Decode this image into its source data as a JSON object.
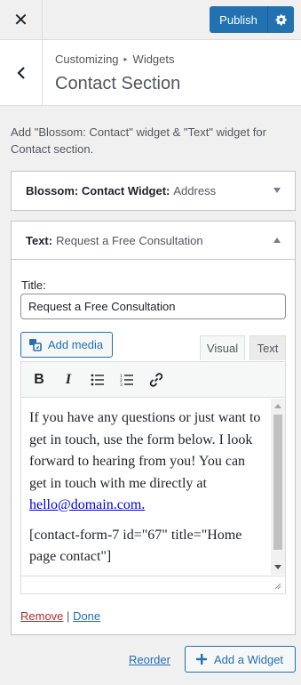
{
  "topbar": {
    "publish_label": "Publish"
  },
  "section": {
    "breadcrumb_root": "Customizing",
    "breadcrumb_child": "Widgets",
    "title": "Contact Section"
  },
  "description": "Add \"Blossom: Contact\" widget & \"Text\" widget for Contact section.",
  "widgets": [
    {
      "name": "Blossom: Contact Widget:",
      "subtitle": "Address"
    },
    {
      "name": "Text:",
      "subtitle": "Request a Free Consultation"
    }
  ],
  "text_widget": {
    "title_label": "Title:",
    "title_value": "Request a Free Consultation",
    "add_media_label": "Add media",
    "tab_visual": "Visual",
    "tab_text": "Text",
    "paragraph1": "If you have any questions or just want to get in touch, use the form below. I look forward to hearing from you! You can get in touch with me directly at ",
    "email_link": "hello@domain.com.",
    "paragraph2": "[contact-form-7 id=\"67\" title=\"Home page contact\"]",
    "remove_label": "Remove",
    "separator": "|",
    "done_label": "Done"
  },
  "footer": {
    "reorder_label": "Reorder",
    "add_widget_label": "Add a Widget"
  },
  "colors": {
    "accent": "#2271b1",
    "remove": "#b32d2e",
    "link": "#0000ee"
  }
}
